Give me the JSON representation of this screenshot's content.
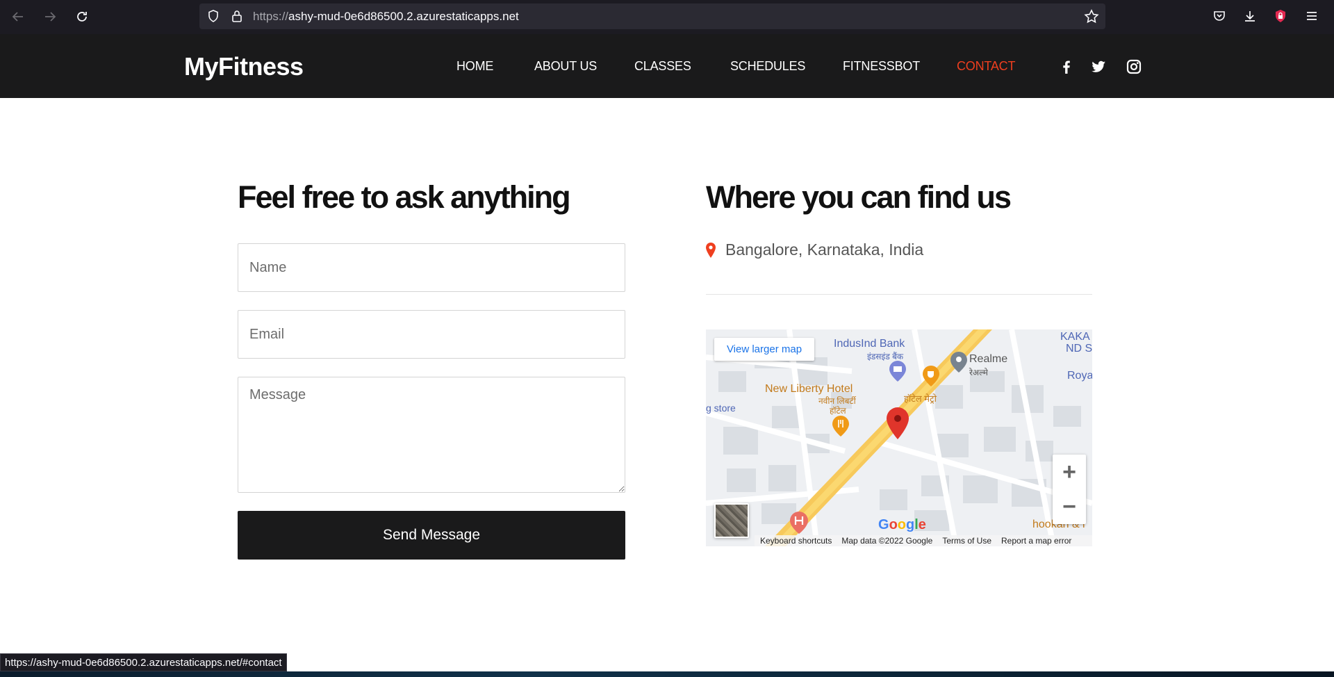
{
  "browser": {
    "url_scheme": "https://",
    "url_host": "ashy-mud-0e6d86500.2.azurestaticapps.net",
    "status_url": "https://ashy-mud-0e6d86500.2.azurestaticapps.net/#contact"
  },
  "header": {
    "brand": "MyFitness",
    "nav": [
      "HOME",
      "ABOUT US",
      "CLASSES",
      "SCHEDULES",
      "FITNESSBOT",
      "CONTACT"
    ],
    "active_nav": "CONTACT",
    "social_icons": [
      "facebook-icon",
      "twitter-icon",
      "instagram-icon"
    ]
  },
  "contact_form": {
    "heading": "Feel free to ask anything",
    "name_placeholder": "Name",
    "email_placeholder": "Email",
    "message_placeholder": "Message",
    "send_label": "Send Message"
  },
  "location": {
    "heading": "Where you can find us",
    "address": "Bangalore, Karnataka, India"
  },
  "map": {
    "larger_map_link": "View larger map",
    "labels": {
      "bank": "IndusInd Bank",
      "bank_hi": "इंडसइंड बैंक",
      "realme": "Realme",
      "realme_hi": "रेअल्मे",
      "hotel": "New Liberty Hotel",
      "hotel_hi1": "नवीन लिबर्टी",
      "hotel_hi2": "हॉटेल",
      "metro_hi": "हॉटेल मेट्रो",
      "store": "g store",
      "kaka": "KAKA",
      "nd": "ND S",
      "roya": "Roya",
      "hookah": "hookah & l"
    },
    "google": "Google",
    "footer": [
      "Keyboard shortcuts",
      "Map data ©2022 Google",
      "Terms of Use",
      "Report a map error"
    ],
    "zoom_in": "+",
    "zoom_out": "−"
  },
  "colors": {
    "accent": "#ef3f1f",
    "header_bg": "#1a1a1b",
    "map_road": "#f7c95b"
  }
}
